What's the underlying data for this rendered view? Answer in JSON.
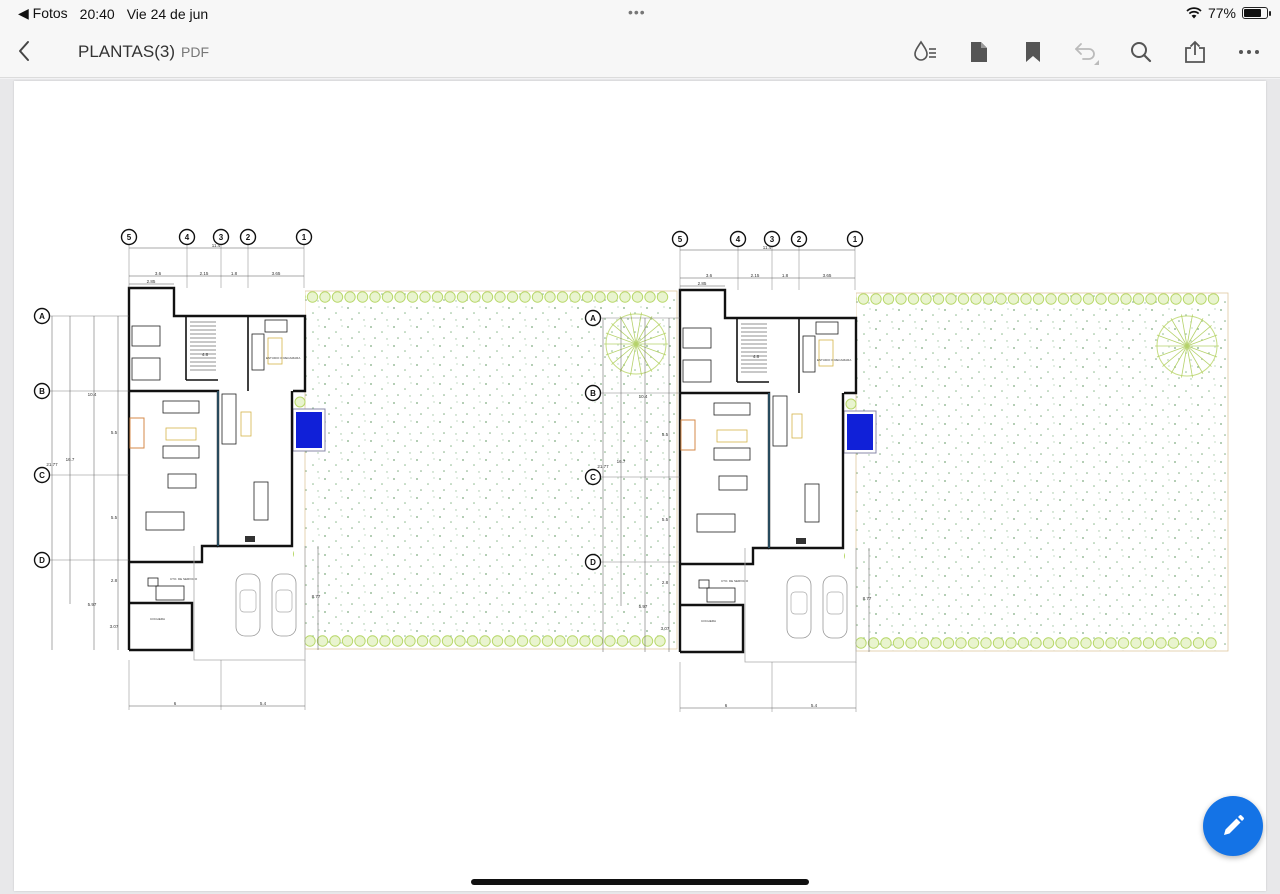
{
  "status": {
    "back_app": "◀ Fotos",
    "time": "20:40",
    "date": "Vie 24 de jun",
    "dots": "•••",
    "battery_text": "77%",
    "battery_level": 0.77
  },
  "toolbar": {
    "title": "PLANTAS(3)",
    "file_type": "PDF",
    "icons": [
      "back-chevron-icon",
      "reading-mode-icon",
      "page-icon",
      "bookmark-icon",
      "undo-icon",
      "search-icon",
      "share-icon",
      "more-icon"
    ]
  },
  "plan": {
    "axes_top": [
      "5",
      "4",
      "3",
      "2",
      "1"
    ],
    "axes_side": [
      "A",
      "B",
      "C",
      "D"
    ],
    "dim_total": "11.4",
    "dims_top": [
      "3.6",
      "2.15",
      "1.8",
      "3.65"
    ],
    "dim_small": "2.85",
    "dims_side": [
      "10.4",
      "16.7",
      "21.77",
      "5.5",
      "5.5",
      "2.8",
      "5.97",
      "3.07"
    ],
    "dim_garage": "8.77",
    "dim_stair": "4.8",
    "dims_bottom": [
      "6",
      "5.4"
    ],
    "room_labels": [
      "ESTUDIO O RECAMARA",
      "CTO. DE SERVICIO",
      "COCHERA"
    ]
  },
  "colors": {
    "accent": "#1473e6",
    "pool": "#1020d8",
    "hedge": "#b8d86a"
  }
}
